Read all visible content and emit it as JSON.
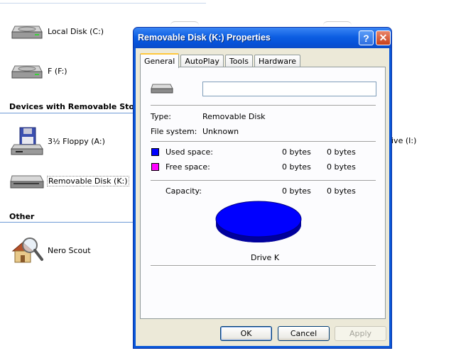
{
  "explorer": {
    "drives": [
      {
        "label": "Local Disk (C:)",
        "icon": "hard-disk-icon"
      },
      {
        "label": "F (F:)",
        "icon": "hard-disk-icon"
      }
    ],
    "removable_section": "Devices with Removable Storage",
    "removable": [
      {
        "label": "3½ Floppy (A:)",
        "icon": "floppy-drive-icon"
      },
      {
        "label": "Removable Disk (K:)",
        "icon": "removable-disk-icon"
      }
    ],
    "right_cut_label": "ive (I:)",
    "other_section": "Other",
    "other": [
      {
        "label": "Nero Scout",
        "icon": "nero-scout-icon"
      }
    ]
  },
  "dialog": {
    "title": "Removable Disk (K:) Properties",
    "help_glyph": "?",
    "close_glyph": "✕",
    "tabs": [
      "General",
      "AutoPlay",
      "Tools",
      "Hardware"
    ],
    "active_tab": "General",
    "name_value": "",
    "type_label": "Type:",
    "type_value": "Removable Disk",
    "fs_label": "File system:",
    "fs_value": "Unknown",
    "used_label": "Used space:",
    "used_bytes": "0 bytes",
    "used_size": "0 bytes",
    "free_label": "Free space:",
    "free_bytes": "0 bytes",
    "free_size": "0 bytes",
    "capacity_label": "Capacity:",
    "capacity_bytes": "0 bytes",
    "capacity_size": "0 bytes",
    "drive_label": "Drive K",
    "buttons": {
      "ok": "OK",
      "cancel": "Cancel",
      "apply": "Apply"
    },
    "colors": {
      "used": "#0000ff",
      "free": "#ff00ff",
      "titlebar": "#0a57d8"
    }
  }
}
